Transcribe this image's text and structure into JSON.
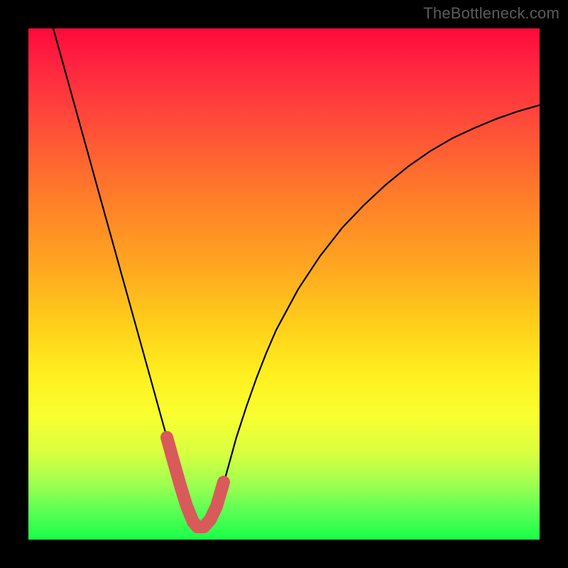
{
  "watermark": "TheBottleneck.com",
  "chart_data": {
    "type": "line",
    "title": "",
    "xlabel": "",
    "ylabel": "",
    "xlim": [
      0,
      100
    ],
    "ylim": [
      0,
      100
    ],
    "grid": false,
    "legend": false,
    "curve_x": [
      4.86,
      6.25,
      7.64,
      9.03,
      10.42,
      11.81,
      13.19,
      14.58,
      15.97,
      17.36,
      18.75,
      20.14,
      21.53,
      22.92,
      24.31,
      25.69,
      27.08,
      29.03,
      30.97,
      32.92,
      34.86,
      36.81,
      38.75,
      40.69,
      42.64,
      44.58,
      46.53,
      48.47,
      52.78,
      57.08,
      61.39,
      65.69,
      70.0,
      74.31,
      78.61,
      82.92,
      87.22,
      91.53,
      95.83,
      100.0
    ],
    "curve_y": [
      100.0,
      95.0,
      90.0,
      85.0,
      80.0,
      75.0,
      70.0,
      65.0,
      60.0,
      55.0,
      50.0,
      45.0,
      40.0,
      35.0,
      30.0,
      25.0,
      20.0,
      13.0,
      6.0,
      2.5,
      2.5,
      6.0,
      13.0,
      20.0,
      26.0,
      31.5,
      36.5,
      41.0,
      49.0,
      55.5,
      61.0,
      65.5,
      69.5,
      73.0,
      76.0,
      78.5,
      80.5,
      82.3,
      83.8,
      85.0
    ],
    "highlight": {
      "color": "#d85a5a",
      "x": [
        27.08,
        28.47,
        29.72,
        30.97,
        32.22,
        33.06,
        34.31,
        35.56,
        36.81,
        38.19
      ],
      "y": [
        20.0,
        15.0,
        10.56,
        6.53,
        3.47,
        2.5,
        2.5,
        3.89,
        6.53,
        11.25
      ]
    },
    "annotations": []
  }
}
